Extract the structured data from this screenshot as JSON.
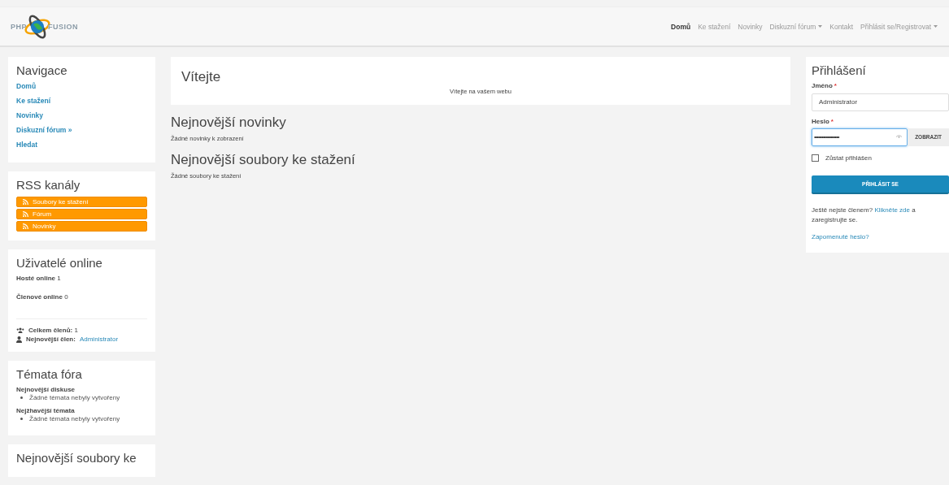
{
  "logo": {
    "left": "PHP",
    "right": "FUSION"
  },
  "navbar": [
    {
      "label": "Domů",
      "selected": true,
      "dropdown": false
    },
    {
      "label": "Ke stažení",
      "selected": false,
      "dropdown": false
    },
    {
      "label": "Novinky",
      "selected": false,
      "dropdown": false
    },
    {
      "label": "Diskuzní fórum",
      "selected": false,
      "dropdown": true
    },
    {
      "label": "Kontakt",
      "selected": false,
      "dropdown": false
    },
    {
      "label": "Přihlásit se/Registrovat",
      "selected": false,
      "dropdown": true
    }
  ],
  "navigation": {
    "title": "Navigace",
    "links": [
      "Domů",
      "Ke stažení",
      "Novinky",
      "Diskuzní fórum »",
      "Hledat"
    ]
  },
  "rss": {
    "title": "RSS kanály",
    "feeds": [
      "Soubory ke stažení",
      "Fórum",
      "Novinky"
    ]
  },
  "users_online": {
    "title": "Uživatelé online",
    "guests": "**Hosté online** 1",
    "members": "**Členové online** 0",
    "total": "**Celkem členů:** 1",
    "newest_label": "Nejnovější člen:",
    "newest_user": "Administrator"
  },
  "forum_topics": {
    "title": "Témata fóra",
    "sections": [
      {
        "heading": "Nejnovější diskuse",
        "items": [
          "Žádné témata nebyly vytvořeny"
        ]
      },
      {
        "heading": "Nejžhavější témata",
        "items": [
          "Žádné témata nebyly vytvořeny"
        ]
      }
    ]
  },
  "latest_downloads_panel": {
    "title": "Nejnovější soubory ke"
  },
  "welcome": {
    "title": "Vítejte",
    "text": "Vítejte na vašem webu"
  },
  "sections": [
    {
      "title": "Nejnovější novinky",
      "text": "Žádné novinky k zobrazení"
    },
    {
      "title": "Nejnovější soubory ke stažení",
      "text": "Žádné soubory ke stažení"
    }
  ],
  "login": {
    "title": "Přihlášení",
    "username_label": "Jméno",
    "username_required": "*",
    "username_value": "Administrator",
    "password_label": "Heslo",
    "password_required": "*",
    "password_value": "•••••••••••••••••",
    "password_focused": true,
    "show_button": "ZOBRAZIT",
    "remember_label": "Zůstat přihlášen",
    "remember_checked": false,
    "submit": "PŘIHLÁSIT SE",
    "register_before": "Ještě nejste členem? ",
    "register_link": "Klikněte zde",
    "register_after": " a zaregistrujte se.",
    "forgot": "Zapomenuté heslo?"
  }
}
